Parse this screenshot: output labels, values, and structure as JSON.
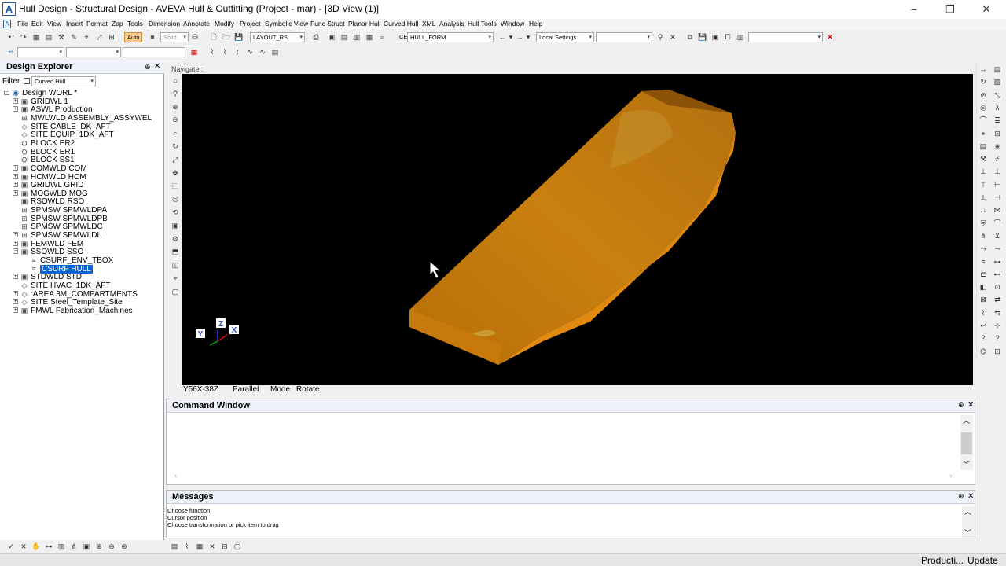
{
  "window": {
    "title": "Hull Design - Structural Design - AVEVA Hull & Outfitting (Project - mar) - [3D View (1)]",
    "app_icon": "A",
    "minimize": "–",
    "restore": "❐",
    "close": "✕"
  },
  "menu": [
    "File",
    "Edit",
    "View",
    "Insert",
    "Format",
    "Zap",
    "Tools",
    "Dimension",
    "Annotate",
    "Modify",
    "Project",
    "Symbolic View",
    "Func Struct",
    "Planar Hull",
    "Curved Hull",
    "XML",
    "Analysis",
    "Hull Tools",
    "Window",
    "Help"
  ],
  "toolbar": {
    "auto_label": "Auto",
    "solid_label": "Solid",
    "layout_value": "LAYOUT_RS",
    "ce_label": "CE",
    "ce_value": "HULL_FORM",
    "settings_value": "Local Settings"
  },
  "explorer": {
    "title": "Design Explorer",
    "filter_label": "Filter",
    "filter_value": "Curved Hull",
    "items": [
      {
        "label": "Design WORL *",
        "level": 0,
        "exp": "−",
        "icon": "◉"
      },
      {
        "label": "GRIDWL 1",
        "level": 1,
        "exp": "+",
        "icon": "▣"
      },
      {
        "label": "ASWL Production",
        "level": 1,
        "exp": "+",
        "icon": "▣"
      },
      {
        "label": "MWLWLD ASSEMBLY_ASSYWEL",
        "level": 1,
        "exp": "",
        "icon": "⊞"
      },
      {
        "label": "SITE CABLE_DK_AFT",
        "level": 1,
        "exp": "",
        "icon": "◇"
      },
      {
        "label": "SITE EQUIP_1DK_AFT",
        "level": 1,
        "exp": "",
        "icon": "◇"
      },
      {
        "label": "BLOCK ER2",
        "level": 1,
        "exp": "",
        "icon": "⛭"
      },
      {
        "label": "BLOCK ER1",
        "level": 1,
        "exp": "",
        "icon": "⛭"
      },
      {
        "label": "BLOCK SS1",
        "level": 1,
        "exp": "",
        "icon": "⛭"
      },
      {
        "label": "COMWLD COM",
        "level": 1,
        "exp": "+",
        "icon": "▣"
      },
      {
        "label": "HCMWLD HCM",
        "level": 1,
        "exp": "+",
        "icon": "▣"
      },
      {
        "label": "GRIDWL GRID",
        "level": 1,
        "exp": "+",
        "icon": "▣"
      },
      {
        "label": "MOGWLD MOG",
        "level": 1,
        "exp": "+",
        "icon": "▣"
      },
      {
        "label": "RSOWLD RSO",
        "level": 1,
        "exp": "",
        "icon": "▣"
      },
      {
        "label": "SPMSW SPMWLDPA",
        "level": 1,
        "exp": "",
        "icon": "⊞"
      },
      {
        "label": "SPMSW SPMWLDPB",
        "level": 1,
        "exp": "",
        "icon": "⊞"
      },
      {
        "label": "SPMSW SPMWLDC",
        "level": 1,
        "exp": "",
        "icon": "⊞"
      },
      {
        "label": "SPMSW SPMWLDL",
        "level": 1,
        "exp": "+",
        "icon": "⊞"
      },
      {
        "label": "FEMWLD FEM",
        "level": 1,
        "exp": "+",
        "icon": "▣"
      },
      {
        "label": "SSOWLD SSO",
        "level": 1,
        "exp": "−",
        "icon": "▣"
      },
      {
        "label": "CSURF_ENV_TBOX",
        "level": 2,
        "exp": "",
        "icon": "≡"
      },
      {
        "label": "CSURF HULL",
        "level": 2,
        "exp": "",
        "icon": "≡",
        "selected": true
      },
      {
        "label": "STDWLD STD",
        "level": 1,
        "exp": "+",
        "icon": "▣"
      },
      {
        "label": "SITE HVAC_1DK_AFT",
        "level": 1,
        "exp": "",
        "icon": "◇"
      },
      {
        "label": ":AREA 3M_COMPARTMENTS",
        "level": 1,
        "exp": "+",
        "icon": "◇"
      },
      {
        "label": "SITE Steel_Template_Site",
        "level": 1,
        "exp": "+",
        "icon": "◇"
      },
      {
        "label": "FMWL Fabrication_Machines",
        "level": 1,
        "exp": "+",
        "icon": "▣"
      }
    ]
  },
  "view": {
    "nav_label": "Navigate :",
    "axis_x": "X",
    "axis_y": "Y",
    "axis_z": "Z",
    "status_orientation": "Y56X-38Z",
    "status_projection": "Parallel",
    "status_mode_label": "Mode",
    "status_mode_value": "Rotate",
    "hull_color": "#e08a0c"
  },
  "command_window": {
    "title": "Command Window"
  },
  "messages": {
    "title": "Messages",
    "lines": [
      "Choose function",
      "Cursor position",
      "Choose transformation or pick item to drag"
    ]
  },
  "statusbar": {
    "production": "Producti...",
    "update": "Update"
  }
}
